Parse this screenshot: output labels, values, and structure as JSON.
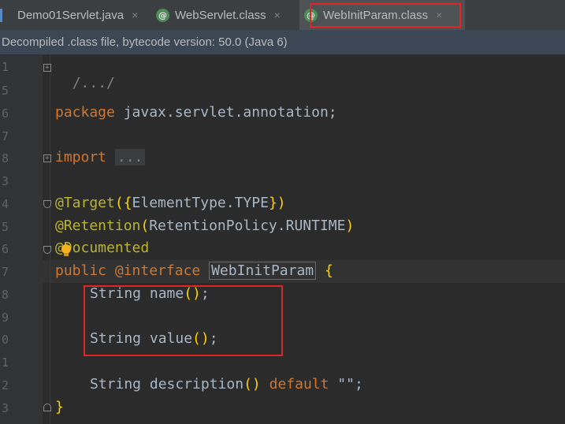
{
  "tabs": [
    {
      "label": "Demo01Servlet.java",
      "close": "×"
    },
    {
      "label": "WebServlet.class",
      "close": "×"
    },
    {
      "label": "WebInitParam.class",
      "close": "×"
    }
  ],
  "class_badge": "@",
  "info_bar": "Decompiled .class file, bytecode version: 50.0 (Java 6)",
  "line_numbers": [
    "1",
    "5",
    "6",
    "7",
    "8",
    "3",
    "4",
    "5",
    "6",
    "7",
    "8",
    "9",
    "0",
    "1",
    "2",
    "3"
  ],
  "code": {
    "header_comment": "/.../",
    "package_kw": "package",
    "package_name": " javax.servlet.annotation;",
    "import_kw": "import",
    "import_collapsed": "...",
    "target_ann": "@Target",
    "target_open": "(",
    "target_brace_open": "{",
    "target_value": "ElementType.TYPE",
    "target_brace_close": "}",
    "target_close": ")",
    "retention_ann": "@Retention",
    "retention_open": "(",
    "retention_value": "RetentionPolicy.RUNTIME",
    "retention_close": ")",
    "documented_ann": "@Documented",
    "public_kw": "public",
    "interface_kw": "@interface",
    "class_name": "WebInitParam",
    "open_brace": "{",
    "name_decl": "String name",
    "name_parens": "()",
    "value_decl": "String value",
    "value_parens": "()",
    "desc_decl": "String description",
    "desc_parens": "()",
    "default_kw": "default",
    "desc_default": " \"\";",
    "semicolon": ";",
    "close_brace": "}"
  }
}
